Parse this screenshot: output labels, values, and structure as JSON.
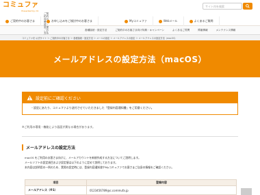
{
  "header": {
    "logo_main": "コミュファ",
    "logo_sub": "Presented by ctc",
    "search_placeholder": "サイト内を検索"
  },
  "mainnav": [
    {
      "label": "ご契約中のお客さま"
    },
    {
      "label": "お申し込みをご検討中のお客さま"
    },
    {
      "label": "Myコミュファ"
    },
    {
      "label": "Webメール"
    },
    {
      "label": "よくあるご質問"
    }
  ],
  "subnav": [
    {
      "label": "ご契約内容の確認・変更／お支払い（Myコミュファ）"
    },
    {
      "label": "各種接続・設定方法"
    },
    {
      "label": "ご契約中のお客さま向け特典・キャンペーン"
    },
    {
      "label": "よくあるご質問"
    },
    {
      "label": "障害情報"
    },
    {
      "label": "メンテナンス情報"
    }
  ],
  "breadcrumb": "コミュファ光 公式サイト ＞ ご契約中のお客さま ＞ 各種接続・設定方法 ＞ メールの設定 ＞ メールアドレスの設定 ＞ メールアドレスの設定方法（macOS）",
  "hero_title": "メールアドレスの設定方法（macOS）",
  "notice": {
    "title": "設定前にご確認ください",
    "body": "・設定にあたり、コミュファより送付させていただきました「登録内容通知書」をご用意ください。"
  },
  "note": "※ご利用の環境・機能により画面が異なる場合があります。",
  "section": {
    "title": "メールアドレスの設定方法",
    "desc_lines": [
      "macOS をご利用のお客さま向けに、メールアカウントを新規作成する方法についてご説明します。",
      "メールソフトの設定項目および設定値は以下のように定めて説明しております。",
      "本内容は説明用の一例のため、実際の設定時には、登録内容通知書やMyコミュファでお客さまご自身の情報をご確認ください。"
    ]
  },
  "table": {
    "headers": [
      "項目",
      "登録内容"
    ],
    "rows": [
      {
        "label": "メールアドレス（※1）",
        "value": "0123456789@c.commufa.jp"
      }
    ]
  }
}
